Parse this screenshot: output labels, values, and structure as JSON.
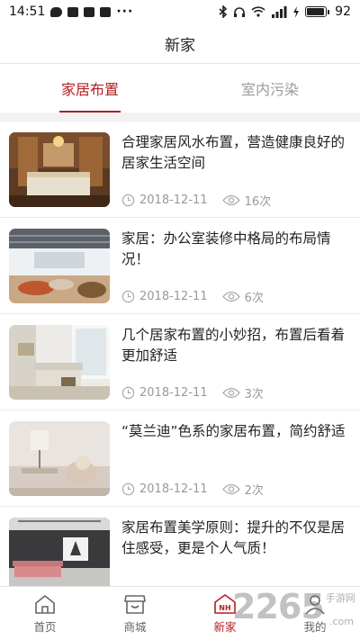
{
  "status_bar": {
    "time": "14:51",
    "battery": "92",
    "battery_level": 0.92
  },
  "header": {
    "title": "新家"
  },
  "tabs": [
    {
      "label": "家居布置",
      "active": true
    },
    {
      "label": "室内污染",
      "active": false
    }
  ],
  "articles": [
    {
      "title": "合理家居风水布置，营造健康良好的居家生活空间",
      "date": "2018-12-11",
      "views": "16次"
    },
    {
      "title": "家居：办公室装修中格局的布局情况！",
      "date": "2018-12-11",
      "views": "6次"
    },
    {
      "title": "几个居家布置的小妙招，布置后看着更加舒适",
      "date": "2018-12-11",
      "views": "3次"
    },
    {
      "title": "“莫兰迪”色系的家居布置，简约舒适",
      "date": "2018-12-11",
      "views": "2次"
    },
    {
      "title": "家居布置美学原则：提升的不仅是居住感受，更是个人气质！",
      "date": "",
      "views": ""
    }
  ],
  "bottom_nav": [
    {
      "label": "首页",
      "icon": "home-icon",
      "active": false
    },
    {
      "label": "商城",
      "icon": "shop-icon",
      "active": false
    },
    {
      "label": "新家",
      "icon": "nh-icon",
      "badge": "NH",
      "active": true
    },
    {
      "label": "我的",
      "icon": "user-icon",
      "active": false
    }
  ],
  "watermark": {
    "number": "2265",
    "site": "手游网",
    "domain": ".com"
  },
  "colors": {
    "accent": "#b41e23",
    "inactive": "#9a9a9a",
    "meta": "#999999",
    "separator": "#f2f2f2"
  }
}
